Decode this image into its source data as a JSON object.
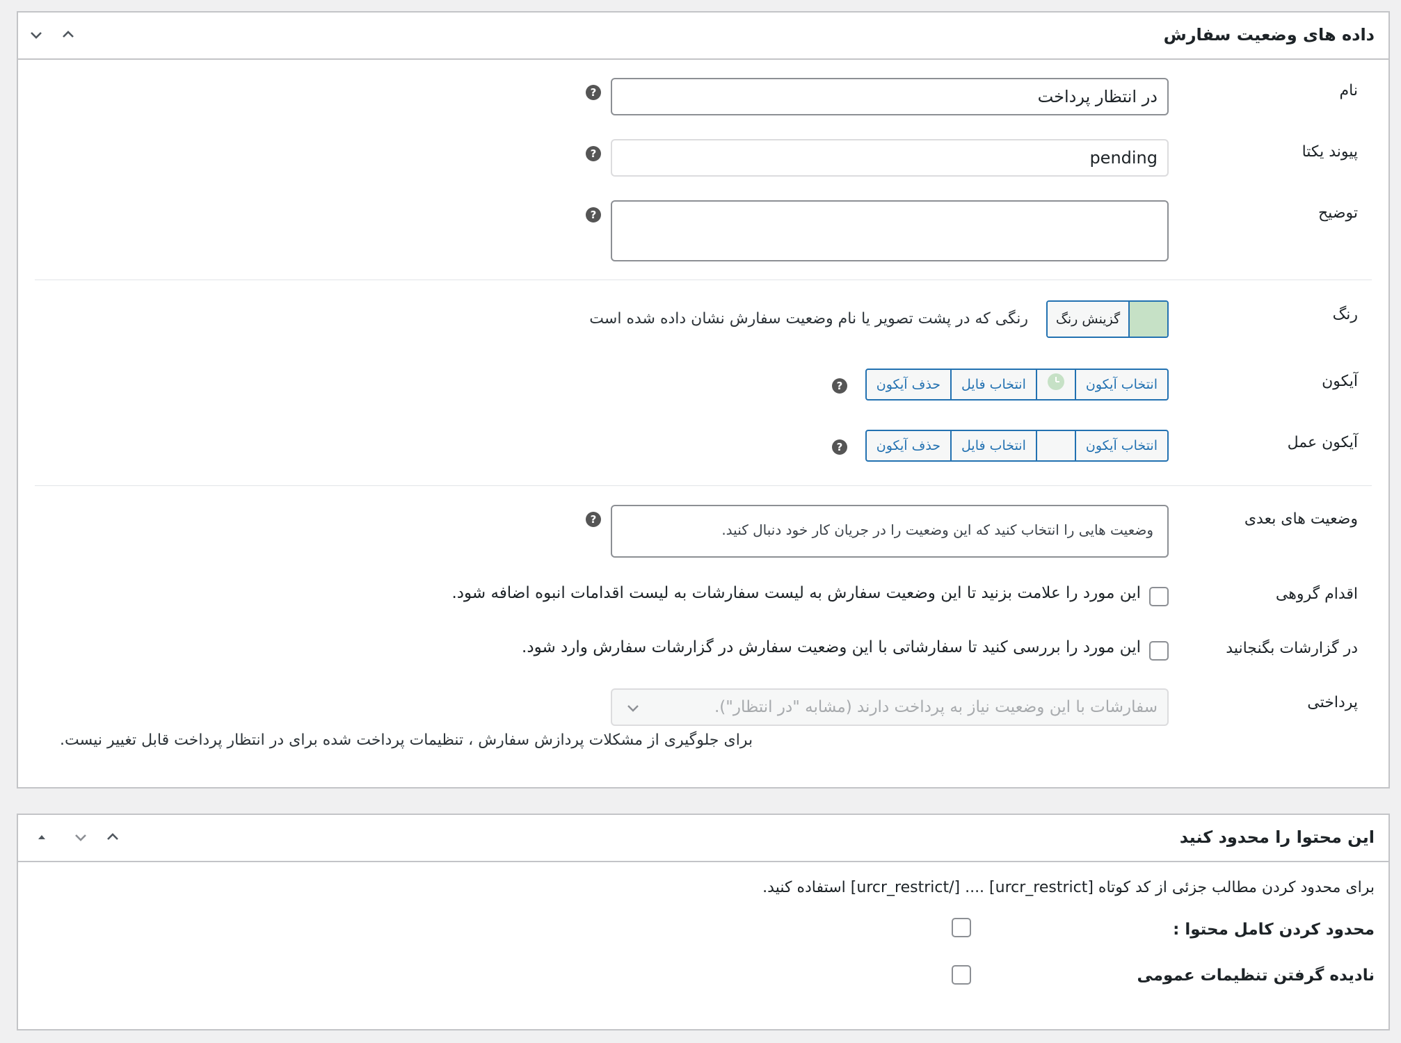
{
  "panel1": {
    "title": "داده های وضعیت سفارش",
    "fields": {
      "name_label": "نام",
      "name_value": "در انتظار پرداخت",
      "slug_label": "پیوند یکتا",
      "slug_value": "pending",
      "desc_label": "توضیح",
      "desc_value": "",
      "color_label": "رنگ",
      "color_button": "گزینش رنگ",
      "color_value": "#c6e1c6",
      "color_desc": "رنگی که در پشت تصویر یا نام وضعیت سفارش نشان داده شده است",
      "icon_label": "آیکون",
      "action_icon_label": "آیکون عمل",
      "select_icon": "انتخاب آیکون",
      "select_file": "انتخاب فایل",
      "remove_icon": "حذف آیکون",
      "next_label": "وضعیت های بعدی",
      "next_placeholder": "وضعیت هایی را انتخاب کنید که این وضعیت را در جریان کار خود دنبال کنید.",
      "bulk_label": "اقدام گروهی",
      "bulk_text": "این مورد را علامت بزنید تا این وضعیت سفارش به لیست سفارشات به لیست اقدامات انبوه اضافه شود.",
      "reports_label": "در گزارشات بگنجانید",
      "reports_text": "این مورد را بررسی کنید تا سفارشاتی با این وضعیت سفارش در گزارشات سفارش وارد شود.",
      "payment_label": "پرداختی",
      "payment_placeholder": "سفارشات با این وضعیت نیاز به پرداخت دارند (مشابه \"در انتظار\").",
      "payment_note": "برای جلوگیری از مشکلات پردازش سفارش ، تنظیمات پرداخت شده برای در انتظار پرداخت قابل تغییر نیست."
    }
  },
  "panel2": {
    "title": "این محتوا را محدود کنید",
    "info": "برای محدود کردن مطالب جزئی از کد کوتاه [urcr_restrict] .... [/urcr_restrict] استفاده کنید.",
    "restrict_label": "محدود کردن کامل محتوا :",
    "ignore_label": "نادیده گرفتن تنظیمات عمومی"
  },
  "icons": {
    "collapse": "chevron-down-icon",
    "expand": "chevron-up-icon",
    "move": "triangle-up-icon",
    "help": "help-icon",
    "clock": "clock-icon",
    "dropdown": "chevron-down-icon"
  }
}
